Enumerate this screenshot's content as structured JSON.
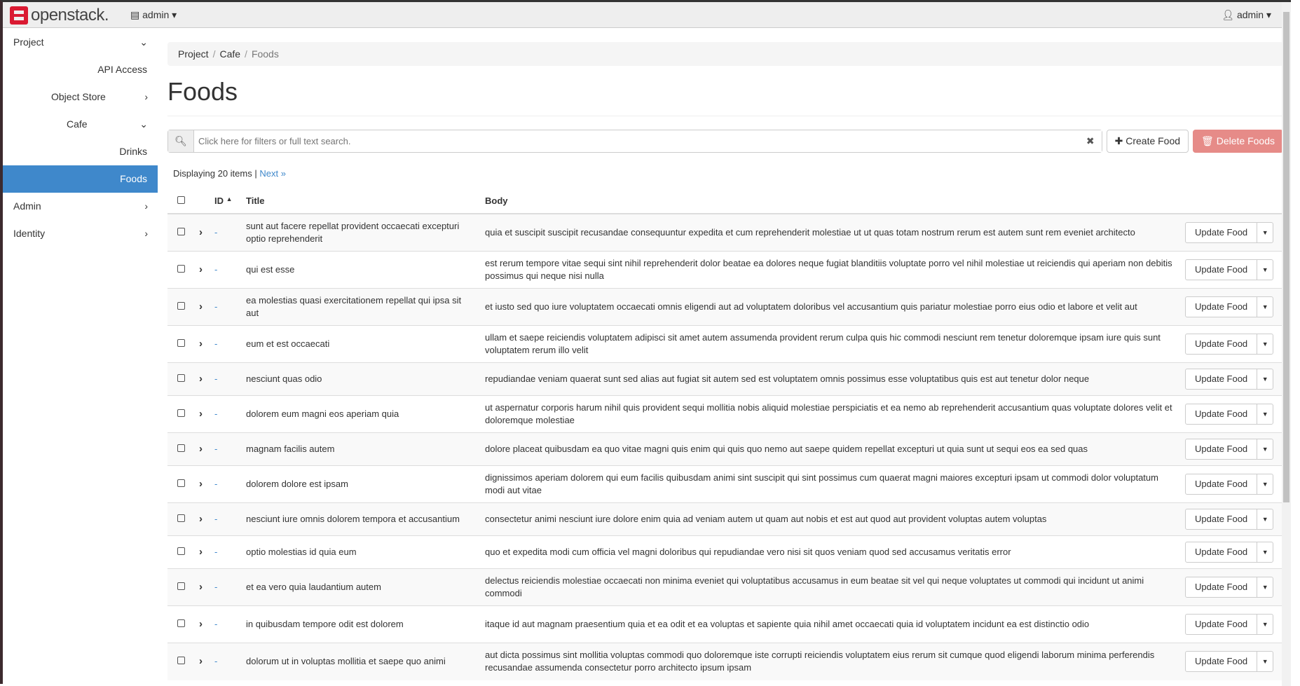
{
  "header": {
    "brand": "openstack.",
    "project_menu": "admin",
    "user_menu": "admin"
  },
  "sidebar": {
    "items": [
      {
        "label": "Project",
        "level": "1",
        "state": "expanded"
      },
      {
        "label": "API Access"
      },
      {
        "label": "Object Store",
        "state": "collapsed"
      },
      {
        "label": "Cafe",
        "state": "expanded"
      },
      {
        "label": "Drinks"
      },
      {
        "label": "Foods",
        "active": true
      },
      {
        "label": "Admin",
        "state": "collapsed"
      },
      {
        "label": "Identity",
        "state": "collapsed"
      }
    ]
  },
  "breadcrumb": [
    "Project",
    "Cafe",
    "Foods"
  ],
  "page_title": "Foods",
  "search": {
    "placeholder": "Click here for filters or full text search."
  },
  "actions": {
    "create": "Create Food",
    "delete": "Delete Foods"
  },
  "pagination": {
    "displaying": "Displaying 20 items",
    "separator": "|",
    "next": "Next »"
  },
  "table": {
    "columns": [
      "ID",
      "Title",
      "Body"
    ],
    "row_action": "Update Food",
    "rows": [
      {
        "id": "-",
        "title": "sunt aut facere repellat provident occaecati excepturi optio reprehenderit",
        "body": "quia et suscipit suscipit recusandae consequuntur expedita et cum reprehenderit molestiae ut ut quas totam nostrum rerum est autem sunt rem eveniet architecto"
      },
      {
        "id": "-",
        "title": "qui est esse",
        "body": "est rerum tempore vitae sequi sint nihil reprehenderit dolor beatae ea dolores neque fugiat blanditiis voluptate porro vel nihil molestiae ut reiciendis qui aperiam non debitis possimus qui neque nisi nulla"
      },
      {
        "id": "-",
        "title": "ea molestias quasi exercitationem repellat qui ipsa sit aut",
        "body": "et iusto sed quo iure voluptatem occaecati omnis eligendi aut ad voluptatem doloribus vel accusantium quis pariatur molestiae porro eius odio et labore et velit aut"
      },
      {
        "id": "-",
        "title": "eum et est occaecati",
        "body": "ullam et saepe reiciendis voluptatem adipisci sit amet autem assumenda provident rerum culpa quis hic commodi nesciunt rem tenetur doloremque ipsam iure quis sunt voluptatem rerum illo velit"
      },
      {
        "id": "-",
        "title": "nesciunt quas odio",
        "body": "repudiandae veniam quaerat sunt sed alias aut fugiat sit autem sed est voluptatem omnis possimus esse voluptatibus quis est aut tenetur dolor neque"
      },
      {
        "id": "-",
        "title": "dolorem eum magni eos aperiam quia",
        "body": "ut aspernatur corporis harum nihil quis provident sequi mollitia nobis aliquid molestiae perspiciatis et ea nemo ab reprehenderit accusantium quas voluptate dolores velit et doloremque molestiae"
      },
      {
        "id": "-",
        "title": "magnam facilis autem",
        "body": "dolore placeat quibusdam ea quo vitae magni quis enim qui quis quo nemo aut saepe quidem repellat excepturi ut quia sunt ut sequi eos ea sed quas"
      },
      {
        "id": "-",
        "title": "dolorem dolore est ipsam",
        "body": "dignissimos aperiam dolorem qui eum facilis quibusdam animi sint suscipit qui sint possimus cum quaerat magni maiores excepturi ipsam ut commodi dolor voluptatum modi aut vitae"
      },
      {
        "id": "-",
        "title": "nesciunt iure omnis dolorem tempora et accusantium",
        "body": "consectetur animi nesciunt iure dolore enim quia ad veniam autem ut quam aut nobis et est aut quod aut provident voluptas autem voluptas"
      },
      {
        "id": "-",
        "title": "optio molestias id quia eum",
        "body": "quo et expedita modi cum officia vel magni doloribus qui repudiandae vero nisi sit quos veniam quod sed accusamus veritatis error"
      },
      {
        "id": "-",
        "title": "et ea vero quia laudantium autem",
        "body": "delectus reiciendis molestiae occaecati non minima eveniet qui voluptatibus accusamus in eum beatae sit vel qui neque voluptates ut commodi qui incidunt ut animi commodi"
      },
      {
        "id": "-",
        "title": "in quibusdam tempore odit est dolorem",
        "body": "itaque id aut magnam praesentium quia et ea odit et ea voluptas et sapiente quia nihil amet occaecati quia id voluptatem incidunt ea est distinctio odio"
      },
      {
        "id": "-",
        "title": "dolorum ut in voluptas mollitia et saepe quo animi",
        "body": "aut dicta possimus sint mollitia voluptas commodi quo doloremque iste corrupti reiciendis voluptatem eius rerum sit cumque quod eligendi laborum minima perferendis recusandae assumenda consectetur porro architecto ipsum ipsam"
      }
    ]
  },
  "colors": {
    "accent": "#3f88cb",
    "danger": "#e68b88",
    "brand": "#da1a32"
  }
}
